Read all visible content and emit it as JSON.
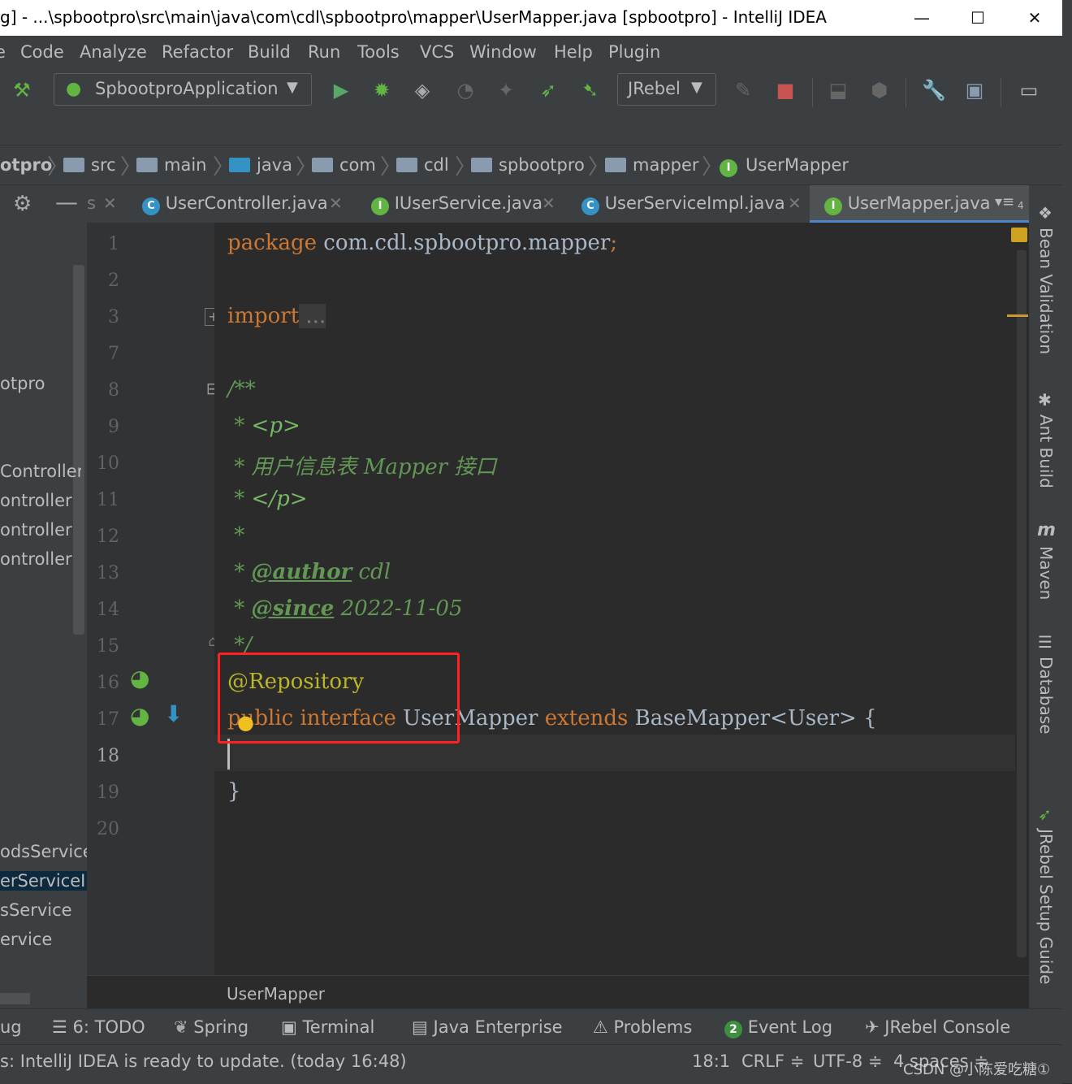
{
  "window": {
    "title": "g] - ...\\spbootpro\\src\\main\\java\\com\\cdl\\spbootpro\\mapper\\UserMapper.java [spbootpro] - IntelliJ IDEA",
    "minimize": "—",
    "maximize": "☐",
    "close": "✕"
  },
  "menu": [
    "e",
    "Code",
    "Analyze",
    "Refactor",
    "Build",
    "Run",
    "Tools",
    "VCS",
    "Window",
    "Help",
    "Plugin"
  ],
  "toolbar": {
    "run_config": "SpbootproApplication",
    "jrebel": "JRebel"
  },
  "breadcrumb": [
    "otpro",
    "src",
    "main",
    "java",
    "com",
    "cdl",
    "spbootpro",
    "mapper",
    "UserMapper"
  ],
  "project_tree": {
    "tab_fragment": "s",
    "items": [
      "otpro",
      "Controller",
      "ontroller",
      "ontroller",
      "ontroller",
      "odsServiceI",
      "erServiceIm",
      "sService",
      "ervice"
    ]
  },
  "tabs": [
    {
      "name": "UserController.java",
      "icon": "C"
    },
    {
      "name": "IUserService.java",
      "icon": "I"
    },
    {
      "name": "UserServiceImpl.java",
      "icon": "C"
    },
    {
      "name": "UserMapper.java",
      "icon": "I",
      "active": true
    }
  ],
  "tab_overflow": "4",
  "line_numbers": [
    "1",
    "2",
    "3",
    "7",
    "8",
    "9",
    "10",
    "11",
    "12",
    "13",
    "14",
    "15",
    "16",
    "17",
    "18",
    "19",
    "20"
  ],
  "code": {
    "l1_kw": "package",
    "l1_rest": " com.cdl.spbootpro.mapper",
    "l1_semi": ";",
    "l3_kw": "import",
    "l3_fold": " ...",
    "l8": "/**",
    "l9_star": " * ",
    "l9_tag": "<p>",
    "l10": " * 用户信息表 Mapper 接口",
    "l11_star": " * ",
    "l11_tag": "</p>",
    "l12": " *",
    "l13_star": " * ",
    "l13_tag": "@author",
    "l13_val": " cdl",
    "l14_star": " * ",
    "l14_tag": "@since",
    "l14_val": " 2022-11-05",
    "l15": " */",
    "l16": "@Repository",
    "l17_kw1": "public interface",
    "l17_name": " UserMapper ",
    "l17_kw2": "extends",
    "l17_rest": " BaseMapper<User> {",
    "l19": "}"
  },
  "editor_breadcrumb": "UserMapper",
  "right_tools": [
    "Bean Validation",
    "Ant Build",
    "Maven",
    "Database",
    "JRebel Setup Guide"
  ],
  "tool_windows": [
    "ug",
    "6: TODO",
    "Spring",
    "Terminal",
    "Java Enterprise",
    "Problems",
    "Event Log",
    "JRebel Console"
  ],
  "event_log_count": "2",
  "status": {
    "message": "s: IntelliJ IDEA is ready to update. (today 16:48)",
    "position": "18:1",
    "line_sep": "CRLF ≑",
    "encoding": "UTF-8 ≑",
    "indent": "4 spaces ≑",
    "watermark": "CSDN @小陈爱吃糖①"
  }
}
